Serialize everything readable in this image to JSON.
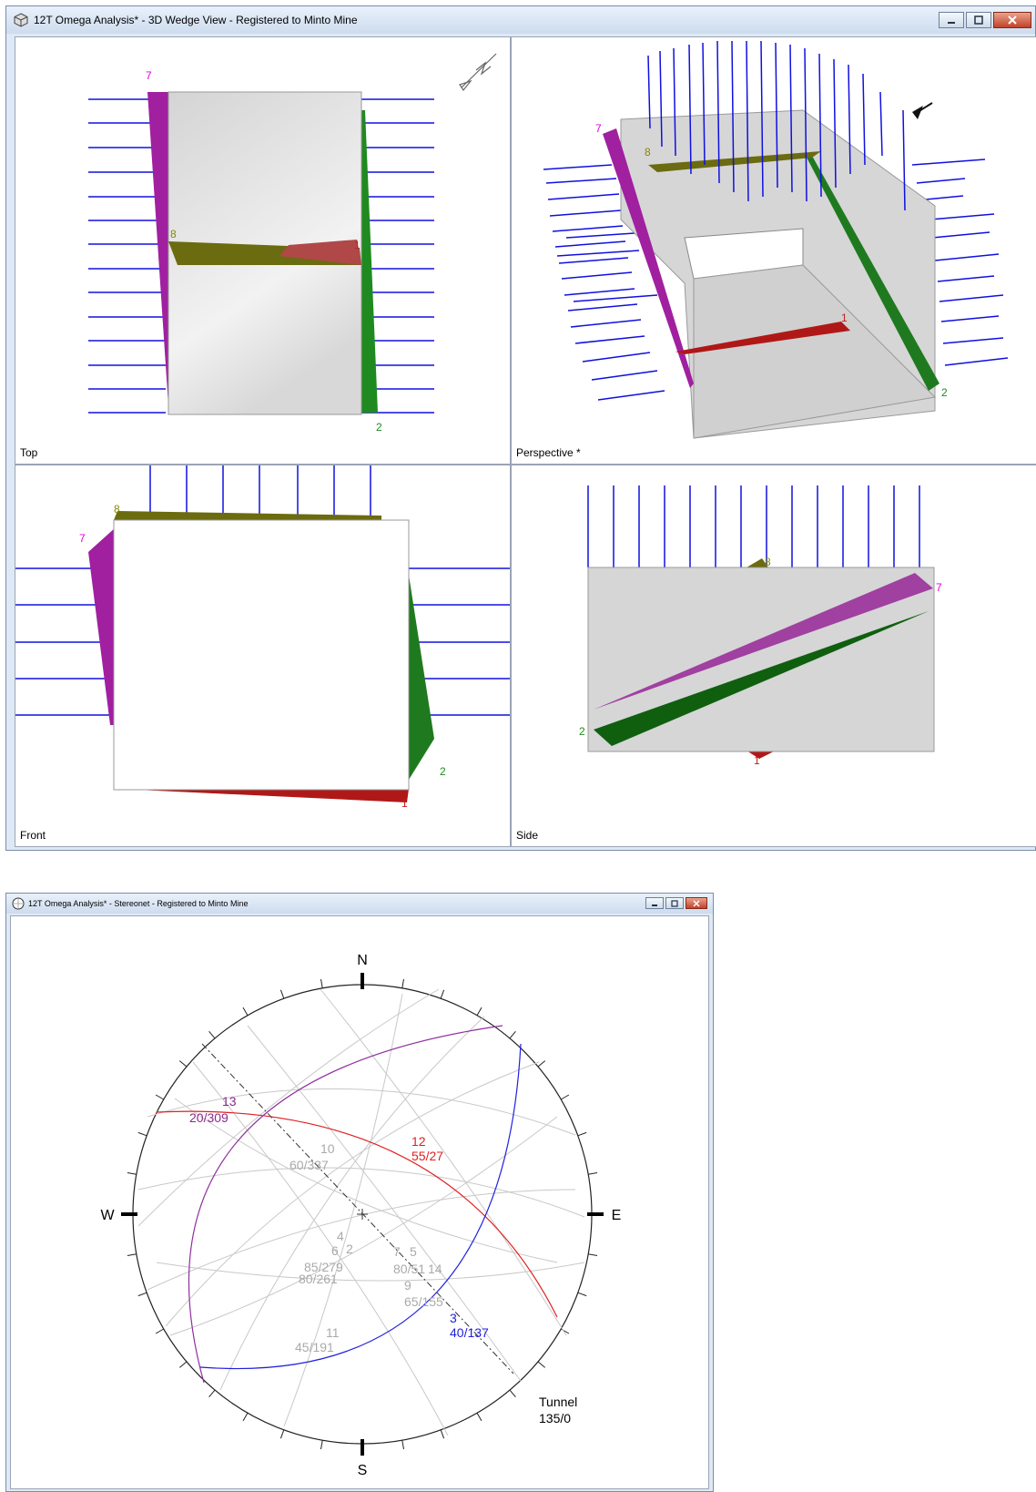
{
  "wedge_window": {
    "title": "12T Omega Analysis* - 3D Wedge View - Registered to Minto Mine",
    "views": {
      "top": "Top",
      "perspective": "Perspective *",
      "front": "Front",
      "side": "Side"
    },
    "wedge_labels": {
      "w7": "7",
      "w8": "8",
      "w1": "1",
      "w2": "2"
    },
    "colors": {
      "purple": "#a020a0",
      "green": "#1f8a1f",
      "red": "#b01818",
      "olive": "#6b6b10",
      "blue": "#0000e0"
    }
  },
  "stereonet_window": {
    "title": "12T Omega Analysis* - Stereonet - Registered to Minto Mine",
    "compass": {
      "n": "N",
      "s": "S",
      "e": "E",
      "w": "W"
    },
    "labels": {
      "l13_id": "13",
      "l13_val": "20/309",
      "l12_id": "12",
      "l12_val": "55/27",
      "l10_id": "10",
      "l10_val": "60/337",
      "l3_id": "3",
      "l3_val": "40/137",
      "l11_id": "11",
      "l11_val": "45/191",
      "l4": "4",
      "l6": "6",
      "l2": "2",
      "l85": "85/279",
      "l80a": "80/261",
      "l7": "7",
      "l5": "5",
      "l80b": "80/51",
      "l14": "14",
      "l9": "9",
      "l65": "65/155",
      "tunnel": "Tunnel",
      "tunnel_val": "135/0"
    }
  }
}
